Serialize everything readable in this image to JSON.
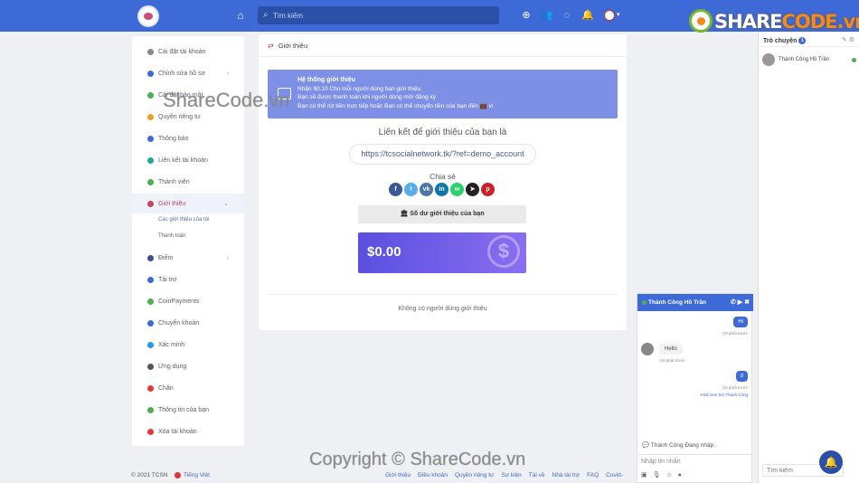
{
  "topbar": {
    "search_placeholder": "Tìm kiếm",
    "icons": [
      "home-icon",
      "search-icon",
      "plus-circle-icon",
      "users-icon",
      "messenger-icon",
      "bell-icon",
      "avatar",
      "chevron-down-icon"
    ]
  },
  "brand": {
    "part1": "SHARE",
    "part2": "CODE.vn"
  },
  "sidebar": {
    "items": [
      {
        "label": "Cài đặt tài khoản",
        "icon": "gear-icon",
        "color": "#888888"
      },
      {
        "label": "Chỉnh sửa hồ sơ",
        "icon": "user-icon",
        "color": "#3d6ad6",
        "chevron": "›"
      },
      {
        "label": "Cài đặt bảo mật",
        "icon": "shield-icon",
        "color": "#4caf50",
        "chevron": "›"
      },
      {
        "label": "Quyền riêng tư",
        "icon": "lock-icon",
        "color": "#f0a020"
      },
      {
        "label": "Thông báo",
        "icon": "bell-icon",
        "color": "#3d6ad6"
      },
      {
        "label": "Liên kết tài khoản",
        "icon": "share-icon",
        "color": "#26a69a"
      },
      {
        "label": "Thành viên",
        "icon": "id-card-icon",
        "color": "#4caf50"
      },
      {
        "label": "Giới thiệu",
        "icon": "exchange-icon",
        "color": "#c2455a",
        "chevron": "⌄"
      },
      {
        "label": "Điểm",
        "icon": "trophy-icon",
        "color": "#3d4a9a",
        "chevron": "›"
      },
      {
        "label": "Tài trợ",
        "icon": "megaphone-icon",
        "color": "#3d6ad6"
      },
      {
        "label": "CoinPayments",
        "icon": "coin-icon",
        "color": "#4caf50"
      },
      {
        "label": "Chuyển khoản",
        "icon": "bank-icon",
        "color": "#3d6ad6"
      },
      {
        "label": "Xác minh",
        "icon": "check-badge-icon",
        "color": "#2196f3"
      },
      {
        "label": "Ứng dụng",
        "icon": "apps-icon",
        "color": "#555555"
      },
      {
        "label": "Chặn",
        "icon": "block-icon",
        "color": "#e53935"
      },
      {
        "label": "Thông tin của bạn",
        "icon": "file-icon",
        "color": "#4caf50"
      },
      {
        "label": "Xóa tài khoản",
        "icon": "trash-icon",
        "color": "#e53935"
      }
    ],
    "sub_items": [
      "Các giới thiệu của tôi",
      "Thanh toán"
    ]
  },
  "main": {
    "title": "Giới thiệu",
    "banner": {
      "line1": "Hệ thống giới thiệu",
      "line2": "Nhận $0.10 Cho mỗi người dùng bạn giới thiệu.",
      "line3": "Bạn sẽ được thanh toán khi người dùng mới đăng ký",
      "line4": "Bạn có thể rút tiền trực tiếp hoặc Bạn có thể chuyển tiền của bạn đến 💼 ví"
    },
    "ref_title": "Liên kết để giới thiệu của bạn là",
    "ref_link": "https://tcsocialnetwork.tk/?ref=demo_account",
    "share_label": "Chia sẻ",
    "share_buttons": [
      {
        "name": "facebook-icon",
        "glyph": "f",
        "color": "#3b5998"
      },
      {
        "name": "twitter-icon",
        "glyph": "t",
        "color": "#55acee"
      },
      {
        "name": "vk-icon",
        "glyph": "vk",
        "color": "#4a76a8"
      },
      {
        "name": "linkedin-icon",
        "glyph": "in",
        "color": "#0e76a8"
      },
      {
        "name": "whatsapp-icon",
        "glyph": "w",
        "color": "#25d366"
      },
      {
        "name": "telegram-icon",
        "glyph": "➤",
        "color": "#222222"
      },
      {
        "name": "pinterest-icon",
        "glyph": "p",
        "color": "#cb2027"
      }
    ],
    "balance_button": "Số dư giới thiệu của bạn",
    "balance": "$0.00",
    "no_referrals": "Không có người dùng giới thiệu"
  },
  "rightbar": {
    "title": "Trò chuyện",
    "badge": "1",
    "user": "Thành Công Hồ Trần",
    "search_placeholder": "Tìm kiếm"
  },
  "chat": {
    "name": "Thành Công Hồ Trần",
    "messages": [
      {
        "dir": "out",
        "text": "Hi",
        "time": "9 phút trước"
      },
      {
        "dir": "in",
        "text": "Hello",
        "time": "6 phút trước"
      },
      {
        "dir": "out",
        "text": "d",
        "time": "6 phút trước"
      }
    ],
    "seen": "Đã xem bởi Thành Công",
    "typing": "Thành Công Đang nhập .",
    "input_placeholder": "Nhập tin nhắn"
  },
  "footer": {
    "copyright": "© 2021 TCSN",
    "language": "Tiếng Việt",
    "links": [
      "Giới thiệu",
      "Điều khoản",
      "Quyền riêng tư",
      "Sự kiện",
      "Tài về",
      "Nhà tài trợ",
      "FAQ",
      "Covid-"
    ]
  },
  "watermarks": {
    "left": "ShareCode.vn",
    "bottom": "Copyright © ShareCode.vn"
  }
}
